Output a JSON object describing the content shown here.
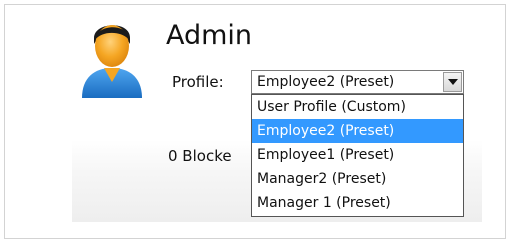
{
  "user": {
    "name": "Admin"
  },
  "profile": {
    "label": "Profile:",
    "selected": "Employee2 (Preset)",
    "options": [
      "User Profile (Custom)",
      "Employee2 (Preset)",
      "Employee1 (Preset)",
      "Manager2 (Preset)",
      "Manager 1 (Preset)"
    ],
    "highlighted_index": 1
  },
  "status": {
    "blocked_text": "0 Blocke"
  },
  "colors": {
    "highlight": "#3399ff",
    "avatar_body": "#2b86d9",
    "avatar_head": "#f5a623"
  }
}
